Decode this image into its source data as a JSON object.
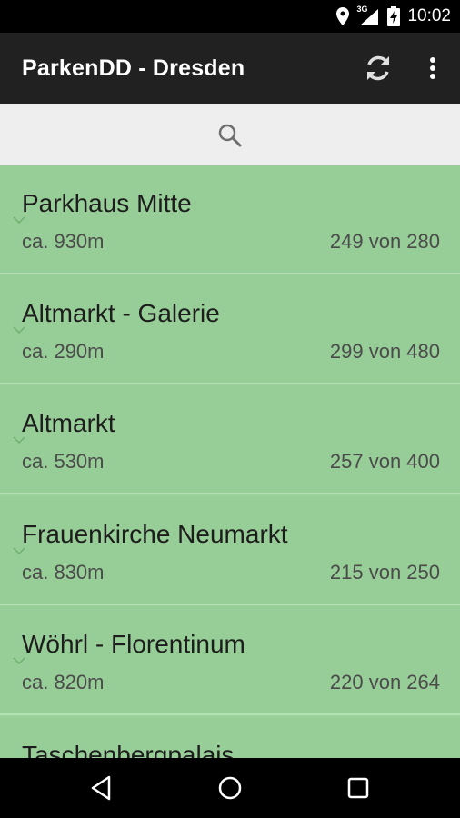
{
  "status": {
    "network": "3G",
    "time": "10:02"
  },
  "appbar": {
    "title": "ParkenDD - Dresden",
    "refresh_icon": "refresh-icon",
    "overflow_icon": "more-vert-icon"
  },
  "search": {
    "icon": "search-icon"
  },
  "colors": {
    "item_bg": "#97cd97",
    "appbar_bg": "#212121",
    "search_bg": "#eeeeee"
  },
  "lots": [
    {
      "name": "Parkhaus Mitte",
      "distance": "ca. 930m",
      "free": "249 von 280"
    },
    {
      "name": "Altmarkt - Galerie",
      "distance": "ca. 290m",
      "free": "299 von 480"
    },
    {
      "name": "Altmarkt",
      "distance": "ca. 530m",
      "free": "257 von 400"
    },
    {
      "name": "Frauenkirche Neumarkt",
      "distance": "ca. 830m",
      "free": "215 von 250"
    },
    {
      "name": "Wöhrl - Florentinum",
      "distance": "ca. 820m",
      "free": "220 von 264"
    },
    {
      "name": "Taschenbergpalais",
      "distance": "",
      "free": ""
    }
  ],
  "nav": {
    "back_icon": "back-icon",
    "home_icon": "home-icon",
    "recents_icon": "recents-icon"
  }
}
